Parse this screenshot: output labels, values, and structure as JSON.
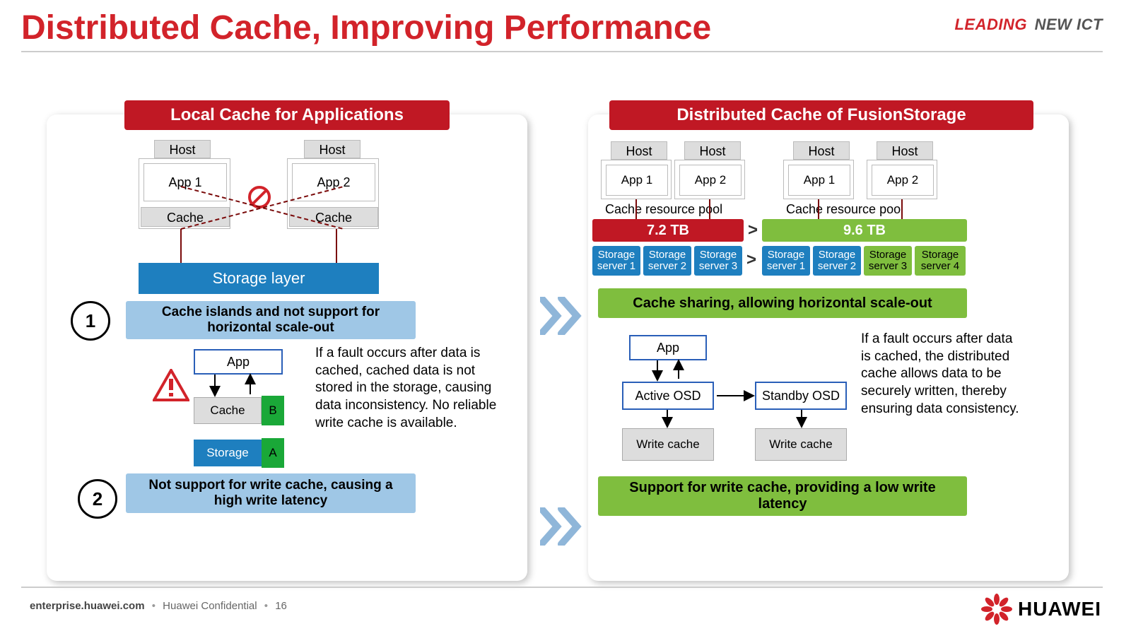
{
  "title": "Distributed Cache, Improving Performance",
  "brand": {
    "leading": "LEADING",
    "newict": "NEW ICT"
  },
  "footer": {
    "site": "enterprise.huawei.com",
    "conf": "Huawei Confidential",
    "page": "16",
    "logo_word": "HUAWEI"
  },
  "left": {
    "header": "Local Cache for Applications",
    "host1": "Host",
    "host2": "Host",
    "app1": "App 1",
    "app2": "App 2",
    "cache": "Cache",
    "storage_layer": "Storage layer",
    "callout1": "Cache islands and not support for horizontal scale-out",
    "callout2": "Not support for write cache, causing a high write latency",
    "num1": "1",
    "num2": "2",
    "mini": {
      "app": "App",
      "cache": "Cache",
      "tagB": "B",
      "storage": "Storage",
      "tagA": "A"
    },
    "para": "If a fault occurs after data is cached, cached data is not stored in the storage, causing data inconsistency. No reliable write cache is available."
  },
  "right": {
    "header": "Distributed Cache of FusionStorage",
    "hostA": "Host",
    "hostB": "Host",
    "hostC": "Host",
    "hostD": "Host",
    "app1": "App 1",
    "app2": "App 2",
    "pool_label": "Cache resource pool",
    "pool_red": "7.2 TB",
    "pool_green": "9.6 TB",
    "gt": ">",
    "srv": [
      "Storage server 1",
      "Storage server 2",
      "Storage server 3",
      "Storage server 1",
      "Storage server 2",
      "Storage server 3",
      "Storage server 4"
    ],
    "callout1": "Cache sharing, allowing horizontal scale-out",
    "mini": {
      "app": "App",
      "active": "Active OSD",
      "standby": "Standby OSD",
      "wc1": "Write cache",
      "wc2": "Write cache"
    },
    "para": "If a fault occurs after data is cached, the distributed cache allows data to be securely written, thereby ensuring data consistency.",
    "callout2": "Support for write cache, providing a low write latency"
  }
}
